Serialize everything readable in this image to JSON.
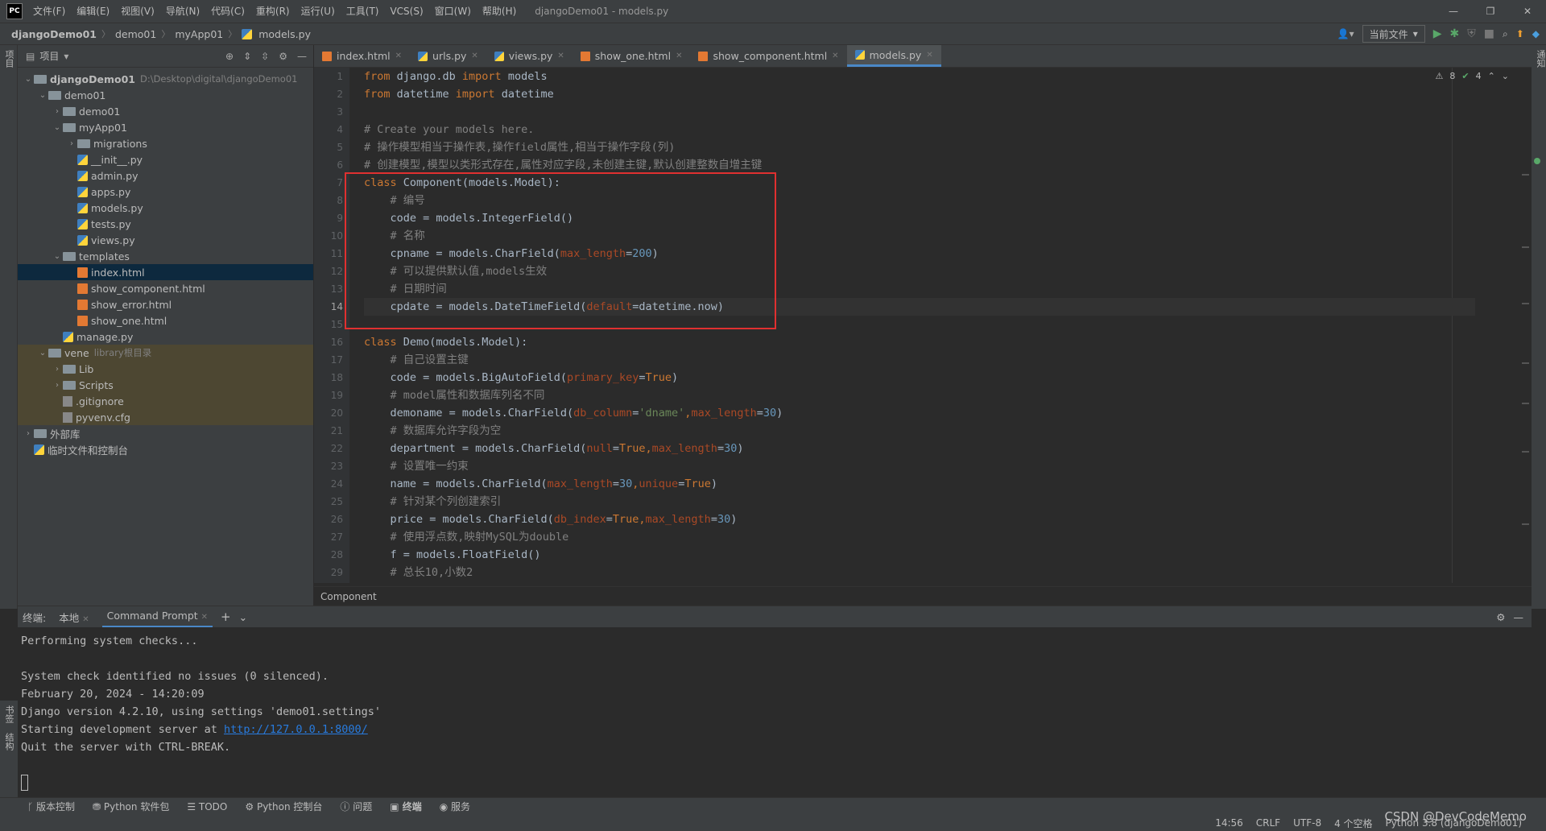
{
  "menubar": {
    "logo": "PC",
    "items": [
      "文件(F)",
      "编辑(E)",
      "视图(V)",
      "导航(N)",
      "代码(C)",
      "重构(R)",
      "运行(U)",
      "工具(T)",
      "VCS(S)",
      "窗口(W)",
      "帮助(H)"
    ],
    "title": "djangoDemo01 - models.py"
  },
  "navbar": {
    "crumbs": [
      "djangoDemo01",
      "demo01",
      "myApp01",
      "models.py"
    ],
    "run_config": "当前文件"
  },
  "project": {
    "header": "项目",
    "tree": [
      {
        "label": "djangoDemo01",
        "extra": "D:\\Desktop\\digital\\djangoDemo01",
        "level": 0,
        "type": "folder",
        "arrow": "v"
      },
      {
        "label": "demo01",
        "level": 1,
        "type": "folder",
        "arrow": "v"
      },
      {
        "label": "demo01",
        "level": 2,
        "type": "folder",
        "arrow": ">"
      },
      {
        "label": "myApp01",
        "level": 2,
        "type": "folder",
        "arrow": "v"
      },
      {
        "label": "migrations",
        "level": 3,
        "type": "folder",
        "arrow": ">"
      },
      {
        "label": "__init__.py",
        "level": 3,
        "type": "py"
      },
      {
        "label": "admin.py",
        "level": 3,
        "type": "py"
      },
      {
        "label": "apps.py",
        "level": 3,
        "type": "py"
      },
      {
        "label": "models.py",
        "level": 3,
        "type": "py"
      },
      {
        "label": "tests.py",
        "level": 3,
        "type": "py"
      },
      {
        "label": "views.py",
        "level": 3,
        "type": "py"
      },
      {
        "label": "templates",
        "level": 2,
        "type": "folder",
        "arrow": "v"
      },
      {
        "label": "index.html",
        "level": 3,
        "type": "html",
        "selected": true
      },
      {
        "label": "show_component.html",
        "level": 3,
        "type": "html"
      },
      {
        "label": "show_error.html",
        "level": 3,
        "type": "html"
      },
      {
        "label": "show_one.html",
        "level": 3,
        "type": "html"
      },
      {
        "label": "manage.py",
        "level": 2,
        "type": "py"
      },
      {
        "label": "vene",
        "extra": "library根目录",
        "level": 1,
        "type": "folder",
        "arrow": "v",
        "excluded": true
      },
      {
        "label": "Lib",
        "level": 2,
        "type": "folder",
        "arrow": ">",
        "excluded": true
      },
      {
        "label": "Scripts",
        "level": 2,
        "type": "folder",
        "arrow": ">",
        "excluded": true
      },
      {
        "label": ".gitignore",
        "level": 2,
        "type": "cfg",
        "excluded": true
      },
      {
        "label": "pyvenv.cfg",
        "level": 2,
        "type": "cfg",
        "excluded": true
      },
      {
        "label": "外部库",
        "level": 0,
        "type": "lib",
        "arrow": ">"
      },
      {
        "label": "临时文件和控制台",
        "level": 0,
        "type": "scratch"
      }
    ]
  },
  "editor": {
    "tabs": [
      {
        "label": "index.html",
        "type": "html"
      },
      {
        "label": "urls.py",
        "type": "py"
      },
      {
        "label": "views.py",
        "type": "py"
      },
      {
        "label": "show_one.html",
        "type": "html"
      },
      {
        "label": "show_component.html",
        "type": "html"
      },
      {
        "label": "models.py",
        "type": "py",
        "active": true
      }
    ],
    "inspections": {
      "warnings": "8",
      "ok": "4"
    },
    "current_line": 14,
    "lines": [
      [
        [
          "kw",
          "from"
        ],
        [
          "t",
          " django.db "
        ],
        [
          "kw",
          "import"
        ],
        [
          "t",
          " models"
        ]
      ],
      [
        [
          "kw",
          "from"
        ],
        [
          "t",
          " datetime "
        ],
        [
          "kw",
          "import"
        ],
        [
          "t",
          " datetime"
        ]
      ],
      [],
      [
        [
          "cm",
          "# Create your models here."
        ]
      ],
      [
        [
          "cm",
          "# 操作模型相当于操作表,操作field属性,相当于操作字段(列)"
        ]
      ],
      [
        [
          "cm",
          "# 创建模型,模型以类形式存在,属性对应字段,未创建主键,默认创建整数自增主键"
        ]
      ],
      [
        [
          "kw",
          "class"
        ],
        [
          "t",
          " Component(models.Model):"
        ]
      ],
      [
        [
          "t",
          "    "
        ],
        [
          "cm",
          "# 编号"
        ]
      ],
      [
        [
          "t",
          "    code = models.IntegerField()"
        ]
      ],
      [
        [
          "t",
          "    "
        ],
        [
          "cm",
          "# 名称"
        ]
      ],
      [
        [
          "t",
          "    cpname = models.CharField("
        ],
        [
          "prm",
          "max_length"
        ],
        [
          "t",
          "="
        ],
        [
          "num",
          "200"
        ],
        [
          "t",
          ")"
        ]
      ],
      [
        [
          "t",
          "    "
        ],
        [
          "cm",
          "# 可以提供默认值,models生效"
        ]
      ],
      [
        [
          "t",
          "    "
        ],
        [
          "cm",
          "# 日期时间"
        ]
      ],
      [
        [
          "t",
          "    cpdate = models.DateTimeField("
        ],
        [
          "prm",
          "default"
        ],
        [
          "t",
          "=datetime.now)"
        ]
      ],
      [],
      [
        [
          "kw",
          "class"
        ],
        [
          "t",
          " Demo(models.Model):"
        ]
      ],
      [
        [
          "t",
          "    "
        ],
        [
          "cm",
          "# 自己设置主键"
        ]
      ],
      [
        [
          "t",
          "    code = models.BigAutoField("
        ],
        [
          "prm",
          "primary_key"
        ],
        [
          "t",
          "="
        ],
        [
          "kw",
          "True"
        ],
        [
          "t",
          ")"
        ]
      ],
      [
        [
          "t",
          "    "
        ],
        [
          "cm",
          "# model属性和数据库列名不同"
        ]
      ],
      [
        [
          "t",
          "    demoname = models.CharField("
        ],
        [
          "prm",
          "db_column"
        ],
        [
          "t",
          "="
        ],
        [
          "str",
          "'dname'"
        ],
        [
          "kw",
          ","
        ],
        [
          "prm",
          "max_length"
        ],
        [
          "t",
          "="
        ],
        [
          "num",
          "30"
        ],
        [
          "t",
          ")"
        ]
      ],
      [
        [
          "t",
          "    "
        ],
        [
          "cm",
          "# 数据库允许字段为空"
        ]
      ],
      [
        [
          "t",
          "    department = models.CharField("
        ],
        [
          "prm",
          "null"
        ],
        [
          "t",
          "="
        ],
        [
          "kw",
          "True"
        ],
        [
          "kw",
          ","
        ],
        [
          "prm",
          "max_length"
        ],
        [
          "t",
          "="
        ],
        [
          "num",
          "30"
        ],
        [
          "t",
          ")"
        ]
      ],
      [
        [
          "t",
          "    "
        ],
        [
          "cm",
          "# 设置唯一约束"
        ]
      ],
      [
        [
          "t",
          "    name = models.CharField("
        ],
        [
          "prm",
          "max_length"
        ],
        [
          "t",
          "="
        ],
        [
          "num",
          "30"
        ],
        [
          "kw",
          ","
        ],
        [
          "prm",
          "unique"
        ],
        [
          "t",
          "="
        ],
        [
          "kw",
          "True"
        ],
        [
          "t",
          ")"
        ]
      ],
      [
        [
          "t",
          "    "
        ],
        [
          "cm",
          "# 针对某个列创建索引"
        ]
      ],
      [
        [
          "t",
          "    price = models.CharField("
        ],
        [
          "prm",
          "db_index"
        ],
        [
          "t",
          "="
        ],
        [
          "kw",
          "True"
        ],
        [
          "kw",
          ","
        ],
        [
          "prm",
          "max_length"
        ],
        [
          "t",
          "="
        ],
        [
          "num",
          "30"
        ],
        [
          "t",
          ")"
        ]
      ],
      [
        [
          "t",
          "    "
        ],
        [
          "cm",
          "# 使用浮点数,映射MySQL为double"
        ]
      ],
      [
        [
          "t",
          "    f = models.FloatField()"
        ]
      ],
      [
        [
          "t",
          "    "
        ],
        [
          "cm",
          "# 总长10,小数2"
        ]
      ]
    ],
    "breadcrumb": "Component"
  },
  "terminal": {
    "label": "终端:",
    "tabs": [
      "本地",
      "Command Prompt"
    ],
    "lines": [
      "Performing system checks...",
      "",
      "System check identified no issues (0 silenced).",
      "February 20, 2024 - 14:20:09",
      "Django version 4.2.10, using settings 'demo01.settings'",
      "Starting development server at ",
      "Quit the server with CTRL-BREAK."
    ],
    "link": "http://127.0.0.1:8000/"
  },
  "toolwindows": [
    "版本控制",
    "Python 软件包",
    "TODO",
    "Python 控制台",
    "问题",
    "终端",
    "服务"
  ],
  "status": {
    "position": "14:56",
    "line_sep": "CRLF",
    "encoding": "UTF-8",
    "indent": "4 个空格",
    "interpreter": "Python 3.8 (djangoDemo01)"
  },
  "left_labels": [
    "项目",
    "书签",
    "结构"
  ],
  "right_labels": [
    "通知"
  ],
  "watermark": "CSDN @DevCodeMemo"
}
